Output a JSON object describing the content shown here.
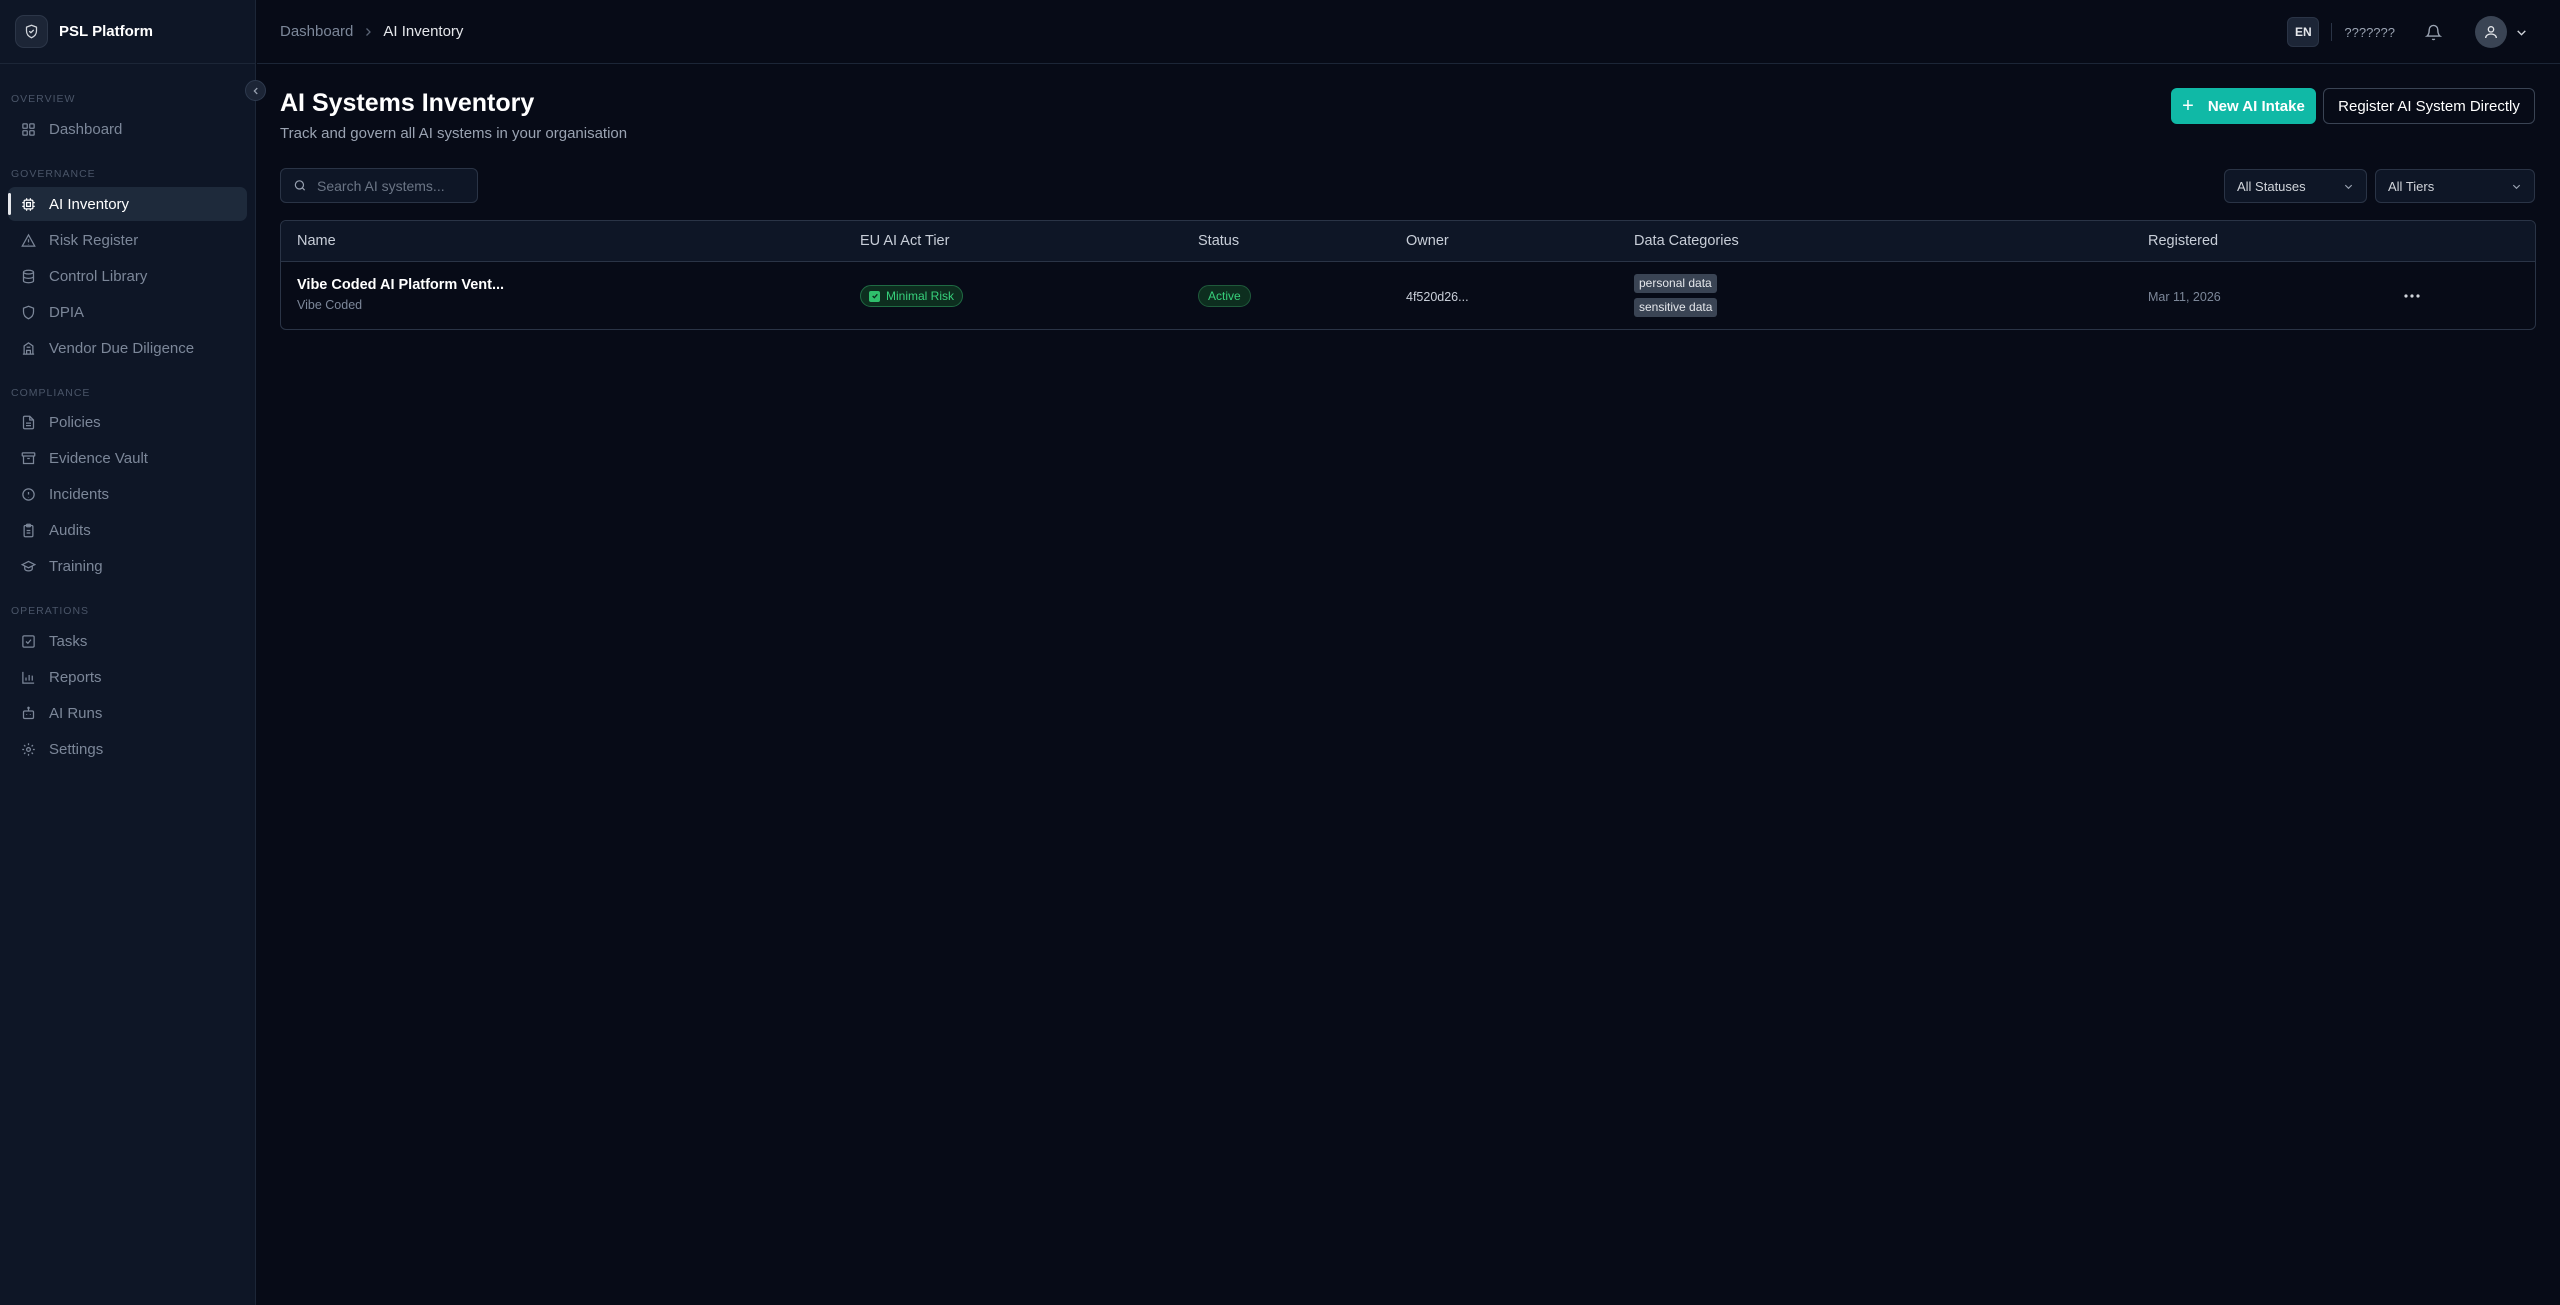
{
  "app": {
    "name": "PSL Platform"
  },
  "sidebar": {
    "sections": [
      {
        "label": "OVERVIEW",
        "items": [
          {
            "label": "Dashboard",
            "icon": "layout-grid-icon"
          }
        ]
      },
      {
        "label": "GOVERNANCE",
        "items": [
          {
            "label": "AI Inventory",
            "icon": "cpu-icon",
            "active": true
          },
          {
            "label": "Risk Register",
            "icon": "alert-triangle-icon"
          },
          {
            "label": "Control Library",
            "icon": "database-icon"
          },
          {
            "label": "DPIA",
            "icon": "shield-icon"
          },
          {
            "label": "Vendor Due Diligence",
            "icon": "building-icon"
          }
        ]
      },
      {
        "label": "COMPLIANCE",
        "items": [
          {
            "label": "Policies",
            "icon": "file-text-icon"
          },
          {
            "label": "Evidence Vault",
            "icon": "archive-icon"
          },
          {
            "label": "Incidents",
            "icon": "alert-circle-icon"
          },
          {
            "label": "Audits",
            "icon": "clipboard-icon"
          },
          {
            "label": "Training",
            "icon": "graduation-cap-icon"
          }
        ]
      },
      {
        "label": "OPERATIONS",
        "items": [
          {
            "label": "Tasks",
            "icon": "check-square-icon"
          },
          {
            "label": "Reports",
            "icon": "bar-chart-icon"
          },
          {
            "label": "AI Runs",
            "icon": "bot-icon"
          },
          {
            "label": "Settings",
            "icon": "gear-icon"
          }
        ]
      }
    ]
  },
  "topbar": {
    "breadcrumb": {
      "parent": "Dashboard",
      "current": "AI Inventory"
    },
    "language": "EN",
    "user_label": "???????"
  },
  "page": {
    "title": "AI Systems Inventory",
    "subtitle": "Track and govern all AI systems in your organisation",
    "new_intake_label": "New AI Intake",
    "register_label": "Register AI System Directly"
  },
  "filters": {
    "search_placeholder": "Search AI systems...",
    "status_value": "All Statuses",
    "tier_value": "All Tiers"
  },
  "table": {
    "columns": {
      "name": "Name",
      "tier": "EU AI Act Tier",
      "status": "Status",
      "owner": "Owner",
      "data_categories": "Data Categories",
      "registered": "Registered"
    },
    "rows": [
      {
        "name": "Vibe Coded AI Platform Vent...",
        "vendor": "Vibe Coded",
        "tier": "Minimal Risk",
        "status": "Active",
        "owner": "4f520d26...",
        "categories": [
          "personal data",
          "sensitive data"
        ],
        "registered": "Mar 11, 2026"
      }
    ]
  },
  "colors": {
    "accent": "#10b9a6",
    "background": "#070b17",
    "sidebar": "#0e1626",
    "success": "#37d07b"
  }
}
